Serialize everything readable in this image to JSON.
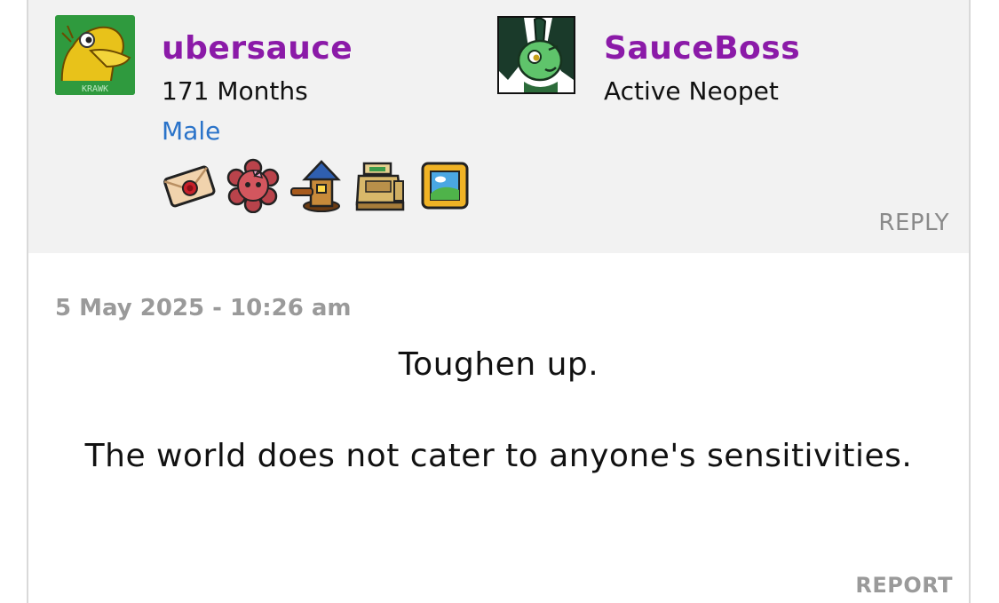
{
  "author": {
    "username": "ubersauce",
    "account_age": "171 Months",
    "gender": "Male",
    "avatar_icon": "krawk-avatar-icon",
    "avatar_caption": "KRAWK",
    "trophies": [
      {
        "icon": "envelope-icon"
      },
      {
        "icon": "flower-face-icon"
      },
      {
        "icon": "tower-icon"
      },
      {
        "icon": "cash-register-icon"
      },
      {
        "icon": "picture-frame-icon"
      }
    ]
  },
  "pet": {
    "name": "SauceBoss",
    "status": "Active Neopet",
    "image_icon": "green-pet-icon"
  },
  "actions": {
    "reply_label": "REPLY",
    "report_label": "REPORT"
  },
  "post": {
    "timestamp": "5 May 2025 - 10:26 am",
    "lines": [
      "Toughen up.",
      "The world does not cater to anyone's sensitivities."
    ]
  },
  "colors": {
    "username": "#8b1aa8",
    "gender": "#2a73c9",
    "header_bg": "#f2f2f2",
    "muted": "#9a9a9a"
  }
}
